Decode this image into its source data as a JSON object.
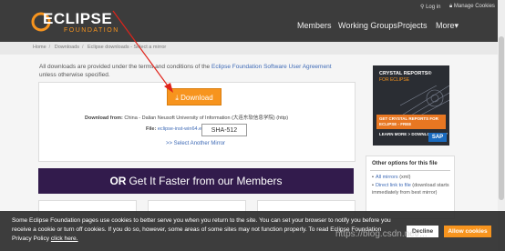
{
  "header": {
    "logo_title": "ECLIPSE",
    "logo_sub": "FOUNDATION",
    "login": "Log in",
    "manage_cookies": "Manage Cookies",
    "nav": [
      "Members",
      "Working Groups",
      "Projects",
      "More▾"
    ]
  },
  "breadcrumb": [
    "Home",
    "Downloads",
    "Eclipse downloads - Select a mirror"
  ],
  "terms": {
    "prefix": "All downloads are provided under the terms and conditions of the ",
    "link": "Eclipse Foundation Software User Agreement",
    "suffix": " unless otherwise specified."
  },
  "download": {
    "button_label": "Download",
    "from_label": "Download from:",
    "from_value": "China - Dalian Neusoft University of Information (大连东软信息学院) (http)",
    "file_label": "File:",
    "file_name": "eclipse-inst-win64.exe",
    "sha_label": "SHA-512",
    "mirror_link": ">> Select Another Mirror"
  },
  "members": {
    "or": "OR",
    "text": "Get It Faster from our Members"
  },
  "ad": {
    "title": "CRYSTAL REPORTS®",
    "subtitle": "FOR ECLIPSE",
    "cta": "GET CRYSTAL REPORTS FOR ECLIPSE - FREE",
    "learn": "LEARN MORE > DOWNLOAD NOW",
    "sap": "SAP"
  },
  "options": {
    "title": "Other options for this file",
    "items": [
      {
        "link": "All mirrors",
        "rest": " (xml)"
      },
      {
        "link": "Direct link to file",
        "rest": " (download starts immediately from best mirror)"
      }
    ]
  },
  "cookie": {
    "text": "Some Eclipse Foundation pages use cookies to better serve you when you return to the site. You can set your browser to notify you before you receive a cookie or turn off cookies. If you do so, however, some areas of some sites may not function properly. To read Eclipse Foundation Privacy Policy ",
    "link": "click here.",
    "decline": "Decline",
    "allow": "Allow cookies"
  },
  "watermark": "https://blog.csdn.net/..."
}
